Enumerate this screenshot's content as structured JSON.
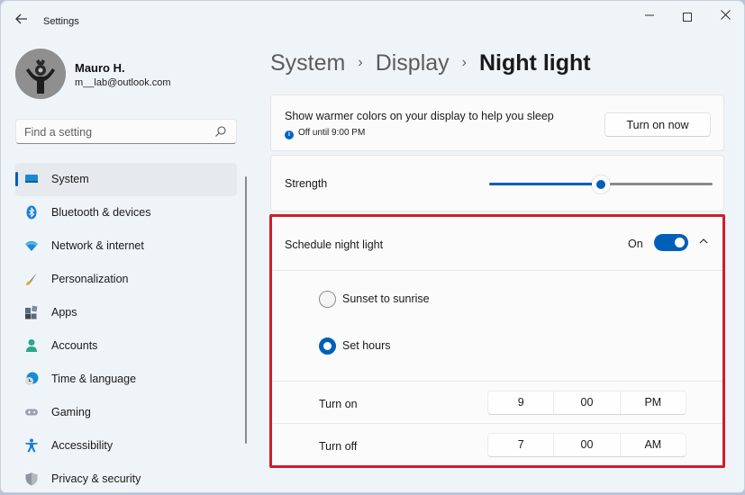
{
  "window": {
    "title": "Settings",
    "back_icon": "arrow-left-icon",
    "controls": {
      "minimize": "minimize-icon",
      "maximize": "maximize-icon",
      "close": "close-icon"
    }
  },
  "user": {
    "name": "Mauro H.",
    "email": "m__lab@outlook.com"
  },
  "search": {
    "placeholder": "Find a setting",
    "value": "",
    "icon": "search-icon"
  },
  "sidebar": {
    "items": [
      {
        "label": "System",
        "icon": "system-icon",
        "active": true
      },
      {
        "label": "Bluetooth & devices",
        "icon": "bluetooth-icon",
        "active": false
      },
      {
        "label": "Network & internet",
        "icon": "network-icon",
        "active": false
      },
      {
        "label": "Personalization",
        "icon": "brush-icon",
        "active": false
      },
      {
        "label": "Apps",
        "icon": "apps-icon",
        "active": false
      },
      {
        "label": "Accounts",
        "icon": "accounts-icon",
        "active": false
      },
      {
        "label": "Time & language",
        "icon": "time-language-icon",
        "active": false
      },
      {
        "label": "Gaming",
        "icon": "gaming-icon",
        "active": false
      },
      {
        "label": "Accessibility",
        "icon": "accessibility-icon",
        "active": false
      },
      {
        "label": "Privacy & security",
        "icon": "shield-icon",
        "active": false
      }
    ]
  },
  "breadcrumb": {
    "items": [
      "System",
      "Display"
    ],
    "current": "Night light",
    "separator": "›"
  },
  "night_light": {
    "description": "Show warmer colors on your display to help you sleep",
    "status": "Off until 9:00 PM",
    "status_icon": "info-icon",
    "turn_on_button": "Turn on now",
    "strength_label": "Strength",
    "strength_percent": 50,
    "schedule": {
      "label": "Schedule night light",
      "toggle_label": "On",
      "toggle_on": true,
      "expanded": true,
      "options": [
        {
          "label": "Sunset to sunrise",
          "checked": false
        },
        {
          "label": "Set hours",
          "checked": true
        }
      ],
      "turn_on": {
        "label": "Turn on",
        "hour": "9",
        "minute": "00",
        "period": "PM"
      },
      "turn_off": {
        "label": "Turn off",
        "hour": "7",
        "minute": "00",
        "period": "AM"
      }
    }
  },
  "colors": {
    "accent": "#005fb8",
    "highlight_border": "#d01d2a",
    "background": "#eff4f9"
  }
}
